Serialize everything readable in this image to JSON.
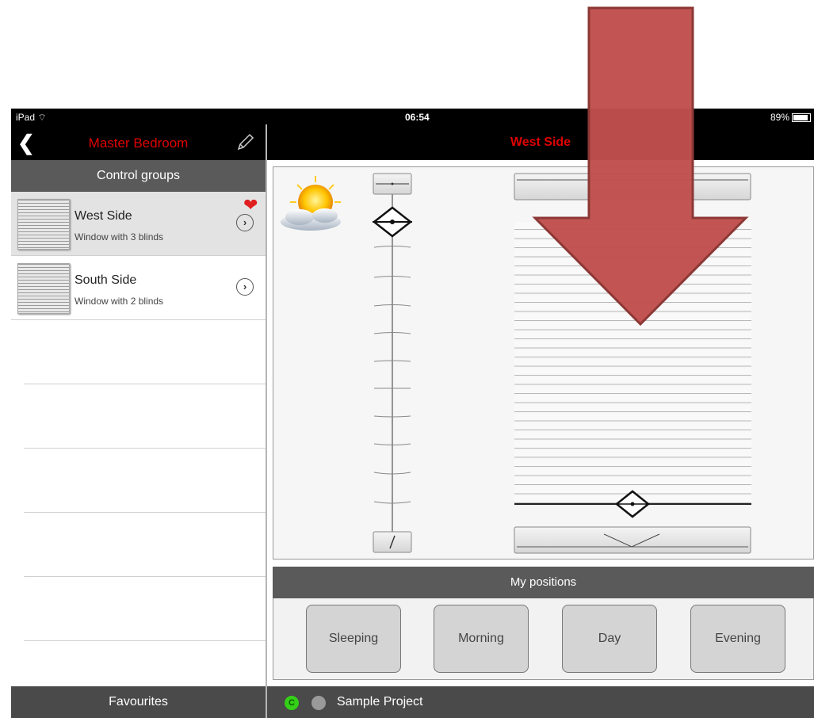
{
  "status_bar": {
    "carrier": "iPad",
    "time": "06:54",
    "battery": "89%"
  },
  "left_nav": {
    "back_icon": "chevron-left-icon",
    "title": "Master Bedroom",
    "edit_icon": "pencil-icon"
  },
  "right_nav": {
    "title": "West Side"
  },
  "sidebar": {
    "header": "Control groups",
    "groups": [
      {
        "name": "West Side",
        "description": "Window with 3 blinds",
        "selected": true,
        "favourite": true
      },
      {
        "name": "South Side",
        "description": "Window with 2 blinds",
        "selected": false,
        "favourite": false
      }
    ]
  },
  "favourites_label": "Favourites",
  "project": {
    "status_letter": "C",
    "name": "Sample Project"
  },
  "control": {
    "weather_icon": "sun-cloud-icon",
    "arrow_color": "#c0504d",
    "accent_color": "#e00000"
  },
  "positions": {
    "header": "My positions",
    "buttons": [
      {
        "label": "Sleeping"
      },
      {
        "label": "Morning"
      },
      {
        "label": "Day"
      },
      {
        "label": "Evening"
      }
    ]
  }
}
